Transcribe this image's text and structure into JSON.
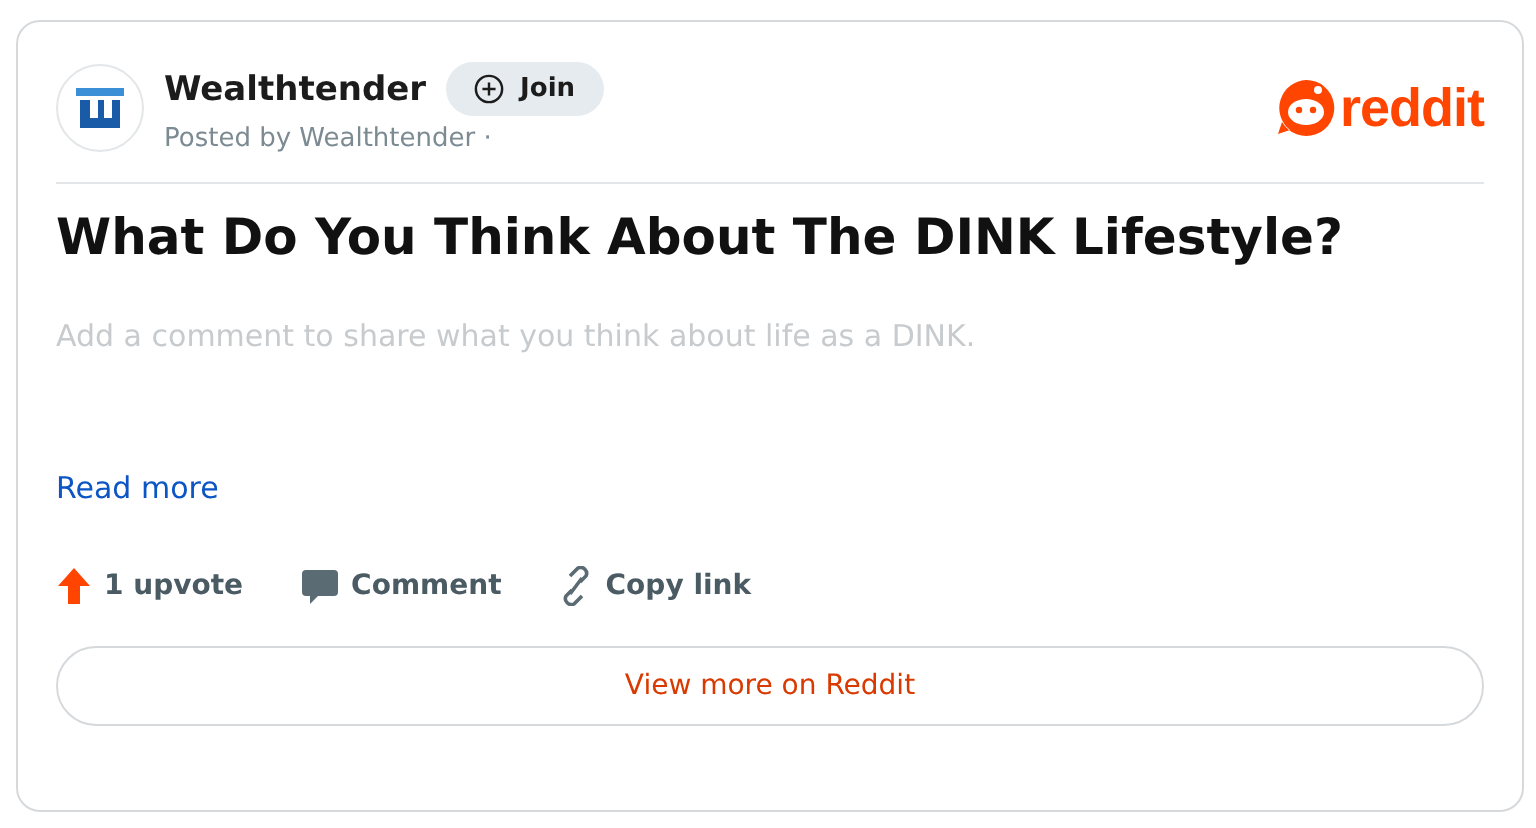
{
  "community": {
    "name": "Wealthtender",
    "join_label": "Join",
    "posted_by": "Posted by Wealthtender ·"
  },
  "logo": {
    "text": "reddit"
  },
  "post": {
    "title": "What Do You Think About The DINK Lifestyle?",
    "body": "Add a comment to share what you think about life as a DINK.",
    "read_more": "Read more"
  },
  "actions": [
    {
      "kind": "upvote",
      "label": "1 upvote"
    },
    {
      "kind": "comment",
      "label": "Comment"
    },
    {
      "kind": "link",
      "label": "Copy link"
    }
  ],
  "footer_button": "View more on Reddit"
}
